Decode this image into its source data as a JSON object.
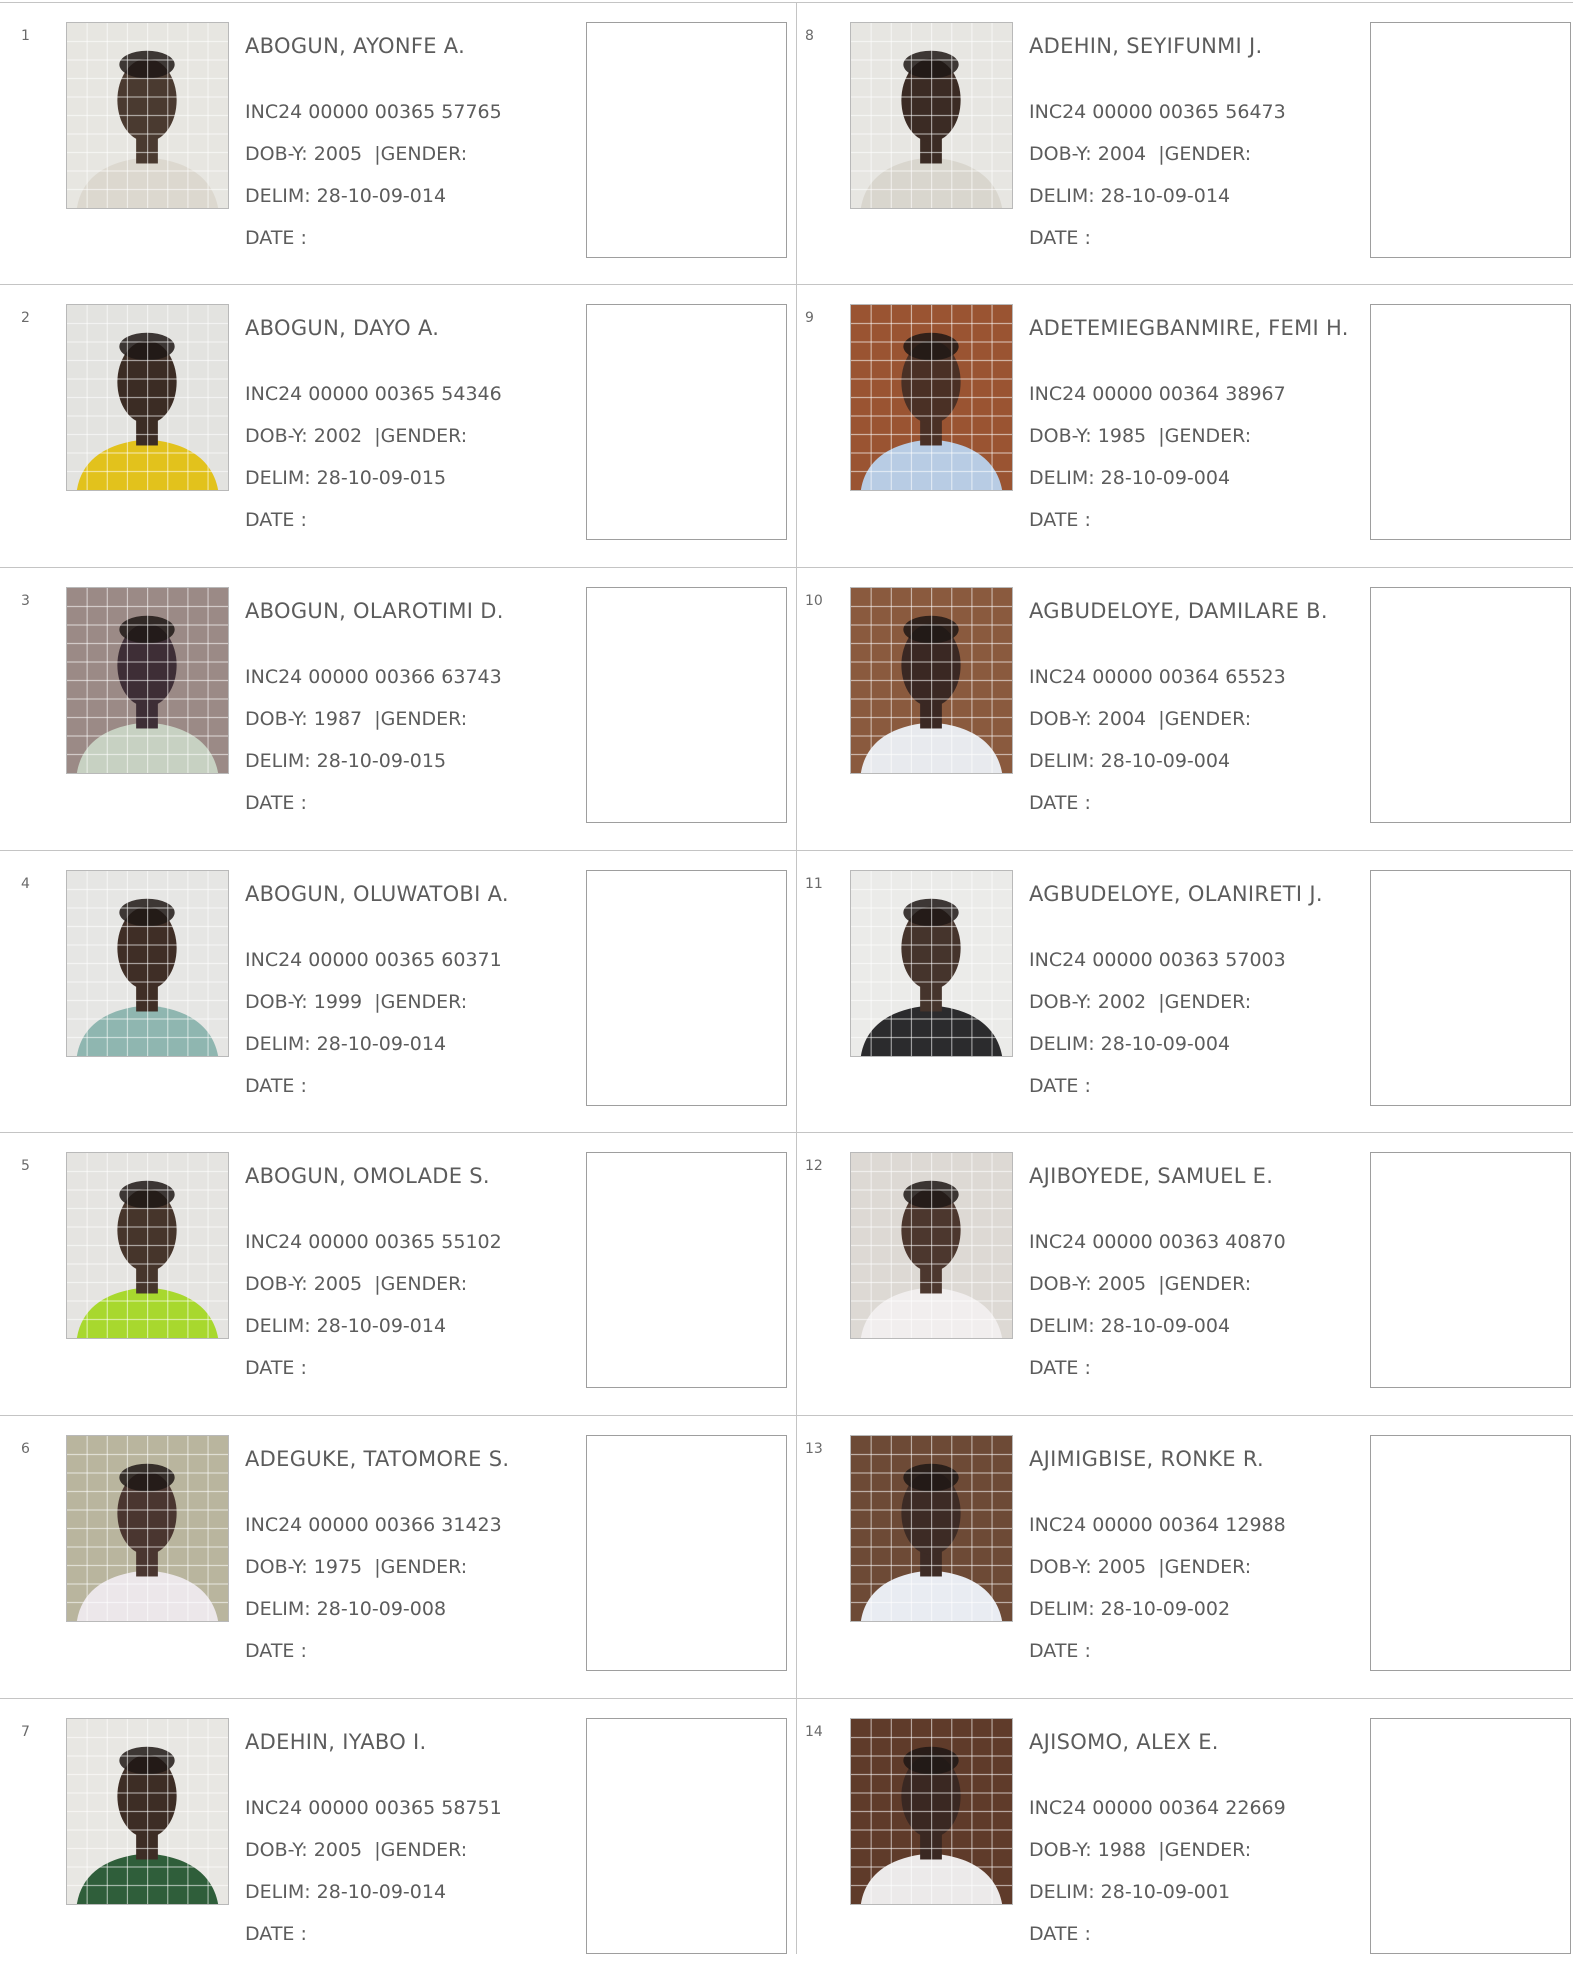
{
  "records": [
    {
      "num": "1",
      "name": "ABOGUN, AYONFE A.",
      "id": "INC24 00000 00365 57765",
      "dob_label": "DOB-Y:",
      "dob": "2005",
      "gender_label": "GENDER:",
      "delim_label": "DELIM:",
      "delim": "28-10-09-014",
      "date_label": "DATE :",
      "photo": {
        "bg": "#e7e6e1",
        "skin": "#4a3a30",
        "cloth": "#dcd8cf"
      }
    },
    {
      "num": "2",
      "name": "ABOGUN, DAYO A.",
      "id": "INC24 00000 00365 54346",
      "dob_label": "DOB-Y:",
      "dob": "2002",
      "gender_label": "GENDER:",
      "delim_label": "DELIM:",
      "delim": "28-10-09-015",
      "date_label": "DATE :",
      "photo": {
        "bg": "#e3e3e0",
        "skin": "#3b2c24",
        "cloth": "#e2c21c"
      }
    },
    {
      "num": "3",
      "name": "ABOGUN, OLAROTIMI D.",
      "id": "INC24 00000 00366 63743",
      "dob_label": "DOB-Y:",
      "dob": "1987",
      "gender_label": "GENDER:",
      "delim_label": "DELIM:",
      "delim": "28-10-09-015",
      "date_label": "DATE :",
      "photo": {
        "bg": "#9b8a86",
        "skin": "#3e2e36",
        "cloth": "#c7d1c2"
      }
    },
    {
      "num": "4",
      "name": "ABOGUN, OLUWATOBI A.",
      "id": "INC24 00000 00365 60371",
      "dob_label": "DOB-Y:",
      "dob": "1999",
      "gender_label": "GENDER:",
      "delim_label": "DELIM:",
      "delim": "28-10-09-014",
      "date_label": "DATE :",
      "photo": {
        "bg": "#e6e6e4",
        "skin": "#3f2e26",
        "cloth": "#8fb6b0"
      }
    },
    {
      "num": "5",
      "name": "ABOGUN, OMOLADE S.",
      "id": "INC24 00000 00365 55102",
      "dob_label": "DOB-Y:",
      "dob": "2005",
      "gender_label": "GENDER:",
      "delim_label": "DELIM:",
      "delim": "28-10-09-014",
      "date_label": "DATE :",
      "photo": {
        "bg": "#e5e4e1",
        "skin": "#46352b",
        "cloth": "#a8d82e"
      }
    },
    {
      "num": "6",
      "name": "ADEGUKE, TATOMORE S.",
      "id": "INC24 00000 00366 31423",
      "dob_label": "DOB-Y:",
      "dob": "1975",
      "gender_label": "GENDER:",
      "delim_label": "DELIM:",
      "delim": "28-10-09-008",
      "date_label": "DATE :",
      "photo": {
        "bg": "#b9b59e",
        "skin": "#4a3630",
        "cloth": "#ece7ea"
      }
    },
    {
      "num": "7",
      "name": "ADEHIN, IYABO I.",
      "id": "INC24 00000 00365 58751",
      "dob_label": "DOB-Y:",
      "dob": "2005",
      "gender_label": "GENDER:",
      "delim_label": "DELIM:",
      "delim": "28-10-09-014",
      "date_label": "DATE :",
      "photo": {
        "bg": "#e8e7e3",
        "skin": "#3d2d25",
        "cloth": "#2f5e3a"
      }
    },
    {
      "num": "8",
      "name": "ADEHIN, SEYIFUNMI J.",
      "id": "INC24 00000 00365 56473",
      "dob_label": "DOB-Y:",
      "dob": "2004",
      "gender_label": "GENDER:",
      "delim_label": "DELIM:",
      "delim": "28-10-09-014",
      "date_label": "DATE :",
      "photo": {
        "bg": "#e7e6e2",
        "skin": "#3b2b24",
        "cloth": "#d9d6ce"
      }
    },
    {
      "num": "9",
      "name": "ADETEMIEGBANMIRE, FEMI H.",
      "id": "INC24 00000 00364 38967",
      "dob_label": "DOB-Y:",
      "dob": "1985",
      "gender_label": "GENDER:",
      "delim_label": "DELIM:",
      "delim": "28-10-09-004",
      "date_label": "DATE :",
      "photo": {
        "bg": "#9a5432",
        "skin": "#4a3025",
        "cloth": "#b8cce4"
      }
    },
    {
      "num": "10",
      "name": "AGBUDELOYE, DAMILARE B.",
      "id": "INC24 00000 00364 65523",
      "dob_label": "DOB-Y:",
      "dob": "2004",
      "gender_label": "GENDER:",
      "delim_label": "DELIM:",
      "delim": "28-10-09-004",
      "date_label": "DATE :",
      "photo": {
        "bg": "#8a5a3e",
        "skin": "#3a2823",
        "cloth": "#e8eaee"
      }
    },
    {
      "num": "11",
      "name": "AGBUDELOYE, OLANIRETI J.",
      "id": "INC24 00000 00363 57003",
      "dob_label": "DOB-Y:",
      "dob": "2002",
      "gender_label": "GENDER:",
      "delim_label": "DELIM:",
      "delim": "28-10-09-004",
      "date_label": "DATE :",
      "photo": {
        "bg": "#ebebe9",
        "skin": "#45342c",
        "cloth": "#2b2b2d"
      }
    },
    {
      "num": "12",
      "name": "AJIBOYEDE, SAMUEL E.",
      "id": "INC24 00000 00363 40870",
      "dob_label": "DOB-Y:",
      "dob": "2005",
      "gender_label": "GENDER:",
      "delim_label": "DELIM:",
      "delim": "28-10-09-004",
      "date_label": "DATE :",
      "photo": {
        "bg": "#ddd9d4",
        "skin": "#4c372e",
        "cloth": "#f1eeee"
      }
    },
    {
      "num": "13",
      "name": "AJIMIGBISE, RONKE R.",
      "id": "INC24 00000 00364 12988",
      "dob_label": "DOB-Y:",
      "dob": "2005",
      "gender_label": "GENDER:",
      "delim_label": "DELIM:",
      "delim": "28-10-09-002",
      "date_label": "DATE :",
      "photo": {
        "bg": "#6d4a36",
        "skin": "#3d2b25",
        "cloth": "#e9ecf2"
      }
    },
    {
      "num": "14",
      "name": "AJISOMO, ALEX E.",
      "id": "INC24 00000 00364 22669",
      "dob_label": "DOB-Y:",
      "dob": "1988",
      "gender_label": "GENDER:",
      "delim_label": "DELIM:",
      "delim": "28-10-09-001",
      "date_label": "DATE :",
      "photo": {
        "bg": "#5f3b2a",
        "skin": "#3a2822",
        "cloth": "#eceaea"
      }
    }
  ]
}
